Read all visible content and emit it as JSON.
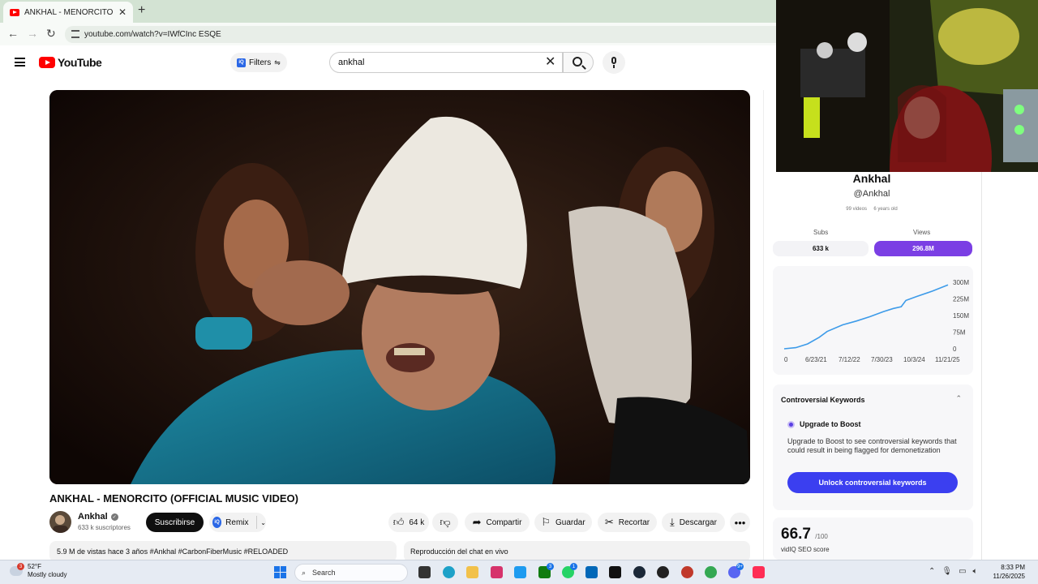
{
  "browser": {
    "tab_title": "ANKHAL - MENORCITO (OFFIC",
    "url": "youtube.com/watch?v=IWfCInc ESQE"
  },
  "youtube": {
    "logo_text": "YouTube",
    "filters_label": "Filters",
    "search_value": "ankhal"
  },
  "video": {
    "title": "ANKHAL - MENORCITO (OFFICIAL MUSIC VIDEO)",
    "channel": "Ankhal",
    "subscribers": "633 k suscriptores",
    "subscribe_label": "Suscribirse",
    "remix_label": "Remix",
    "likes": "64 k",
    "share_label": "Compartir",
    "save_label": "Guardar",
    "clip_label": "Recortar",
    "download_label": "Descargar",
    "views_line": "5.9 M de vistas  hace 3 años  #Ankhal #CarbonFiberMusic #RELOADED",
    "chat_replay": "Reproducción del chat en vivo"
  },
  "vidiq": {
    "channel_name": "Ankhal",
    "handle": "@Ankhal",
    "videos_count": "99 videos",
    "channel_age": "6 years old",
    "subs_label": "Subs",
    "views_label": "Views",
    "subs_value": "633 k",
    "views_value": "296.8M",
    "keywords_title": "Controversial Keywords",
    "upgrade_title": "Upgrade to Boost",
    "upgrade_desc": "Upgrade to Boost to see controversial keywords that could result in being flagged for demonetization",
    "unlock_label": "Unlock controversial keywords",
    "seo_score": "66.7",
    "seo_max": "/100",
    "seo_label": "vidIQ SEO score"
  },
  "chart_data": {
    "type": "line",
    "x": [
      "6/23/21",
      "7/12/22",
      "7/30/23",
      "10/3/24",
      "11/21/25"
    ],
    "x_first_label": "0",
    "y_ticks": [
      "0",
      "75M",
      "150M",
      "225M",
      "300M"
    ],
    "ylim": [
      0,
      300
    ],
    "series": [
      {
        "values": [
          [
            0,
            0
          ],
          [
            0.3,
            5
          ],
          [
            0.6,
            22
          ],
          [
            0.9,
            52
          ],
          [
            1.1,
            78
          ],
          [
            1.5,
            108
          ],
          [
            1.85,
            125
          ],
          [
            2.2,
            145
          ],
          [
            2.55,
            168
          ],
          [
            2.8,
            182
          ],
          [
            3.0,
            190
          ],
          [
            3.12,
            218
          ],
          [
            3.4,
            236
          ],
          [
            3.8,
            260
          ],
          [
            4.2,
            288
          ]
        ]
      }
    ],
    "line_color": "#3d9be9"
  },
  "taskbar": {
    "weather_temp": "52°F",
    "weather_desc": "Mostly cloudy",
    "weather_badge": "3",
    "search_label": "Search",
    "time": "8:33 PM",
    "date": "11/26/2025",
    "xbox_badge": "3",
    "whatsapp_badge": "1",
    "discord_badge": "9+"
  }
}
